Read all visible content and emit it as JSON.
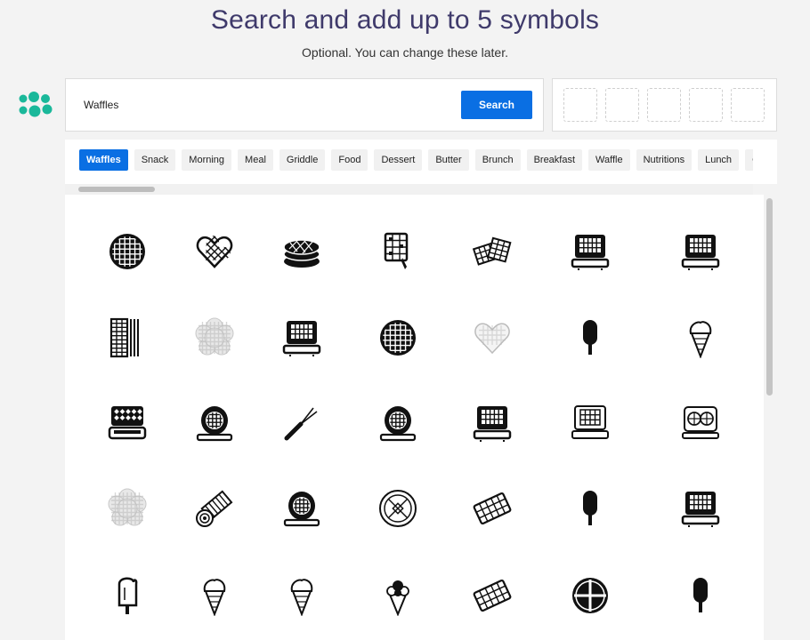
{
  "header": {
    "title": "Search and add up to 5 symbols",
    "subtitle": "Optional. You can change these later."
  },
  "search": {
    "value": "Waffles",
    "button_label": "Search"
  },
  "selected_slots_count": 5,
  "tags": [
    "Waffles",
    "Snack",
    "Morning",
    "Meal",
    "Griddle",
    "Food",
    "Dessert",
    "Butter",
    "Brunch",
    "Breakfast",
    "Waffle",
    "Nutritions",
    "Lunch",
    "G"
  ],
  "active_tag": "Waffles",
  "colors": {
    "accent": "#0a6fe3",
    "title": "#3f3a6b",
    "logo": "#1ab89a"
  },
  "icons": [
    [
      "round-waffle-icon",
      "heart-waffle-icon",
      "waffle-stack-icon",
      "waffle-on-fork-icon",
      "waffle-pieces-icon",
      "waffle-maker-icon",
      "waffle-maker-icon"
    ],
    [
      "belgian-waffle-strip-icon",
      "flower-waffle-light-icon",
      "waffle-maker-icon",
      "round-waffle-icon",
      "heart-waffle-light-icon",
      "popsicle-icon",
      "ice-cream-cone-icon"
    ],
    [
      "waffle-iron-open-icon",
      "round-waffle-maker-icon",
      "waffle-fork-icon",
      "round-waffle-maker-icon",
      "waffle-maker-icon",
      "waffle-maker-outline-icon",
      "double-waffle-maker-icon"
    ],
    [
      "flower-waffle-light-icon",
      "waffle-roll-icon",
      "round-waffle-maker-icon",
      "round-waffle-outline-icon",
      "waffle-piece-icon",
      "popsicle-icon",
      "waffle-maker-icon"
    ],
    [
      "popsicle-bitten-icon",
      "ice-cream-cone-icon",
      "ice-cream-cone-icon",
      "ice-cream-scoops-icon",
      "waffle-piece-icon",
      "round-waffle-quarters-icon",
      "popsicle-icon"
    ]
  ]
}
